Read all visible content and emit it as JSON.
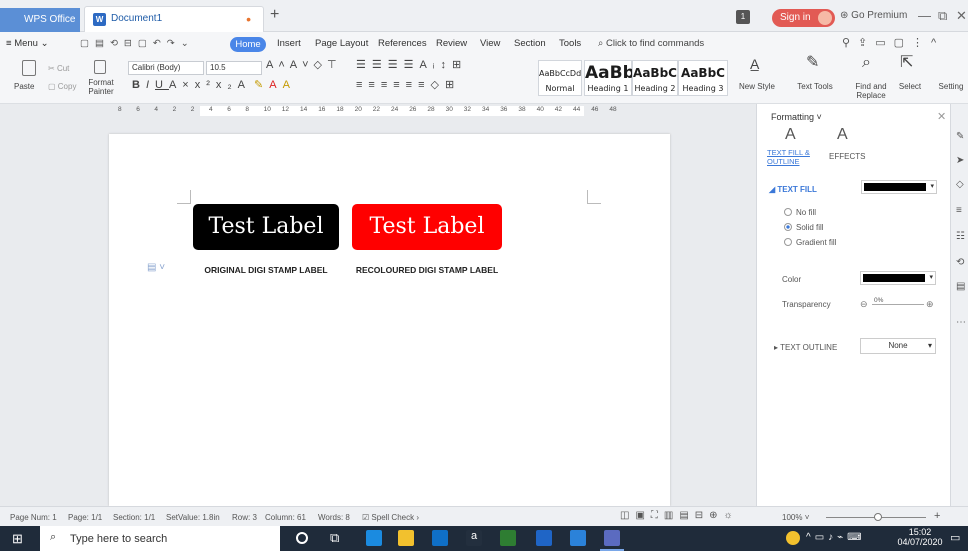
{
  "titlebar": {
    "app_tab": "WPS Office",
    "doc_tab": "Document1",
    "new_tab": "+",
    "badge": "1",
    "signin": "Sign in",
    "premium": "Go Premium"
  },
  "menu": {
    "menu_label": "Menu",
    "tabs": [
      "Home",
      "Insert",
      "Page Layout",
      "References",
      "Review",
      "View",
      "Section",
      "Tools"
    ],
    "find": "Click to find commands"
  },
  "ribbon": {
    "paste": "Paste",
    "cut": "Cut",
    "copy": "Copy",
    "format_painter": "Format Painter",
    "font": "Calibri (Body)",
    "size": "10.5",
    "styles": [
      {
        "preview": "AaBbCcDd",
        "name": "Normal"
      },
      {
        "preview": "AaBb",
        "name": "Heading 1"
      },
      {
        "preview": "AaBbC",
        "name": "Heading 2"
      },
      {
        "preview": "AaBbC",
        "name": "Heading 3"
      }
    ],
    "new_style": "New Style",
    "text_tools": "Text Tools",
    "find_replace": "Find and Replace",
    "select": "Select",
    "settings": "Setting"
  },
  "ruler_numbers": [
    "8",
    "6",
    "4",
    "2",
    "2",
    "4",
    "6",
    "8",
    "10",
    "12",
    "14",
    "16",
    "18",
    "20",
    "22",
    "24",
    "26",
    "28",
    "30",
    "32",
    "34",
    "36",
    "38",
    "40",
    "42",
    "44",
    "46",
    "48"
  ],
  "document": {
    "label_text": "Test Label",
    "caption_original": "ORIGINAL DIGI STAMP LABEL",
    "caption_recoloured": "RECOLOURED DIGI STAMP LABEL",
    "colors": {
      "original": "#000000",
      "recoloured": "#ff0000"
    }
  },
  "panel": {
    "title": "Formatting",
    "tab_fill": "TEXT FILL & OUTLINE",
    "tab_effects": "EFFECTS",
    "text_fill": "TEXT FILL",
    "no_fill": "No fill",
    "solid_fill": "Solid fill",
    "gradient_fill": "Gradient fill",
    "color": "Color",
    "transparency": "Transparency",
    "transparency_value": "0%",
    "text_outline": "TEXT OUTLINE",
    "outline_value": "None",
    "fill_color": "#000000"
  },
  "status": {
    "page_num": "Page Num: 1",
    "page": "Page: 1/1",
    "section": "Section: 1/1",
    "setvalue": "SetValue: 1.8in",
    "row": "Row: 3",
    "column": "Column: 61",
    "words": "Words: 8",
    "spell": "Spell Check",
    "zoom": "100%"
  },
  "taskbar": {
    "search": "Type here to search",
    "time": "15:02",
    "date": "04/07/2020"
  }
}
